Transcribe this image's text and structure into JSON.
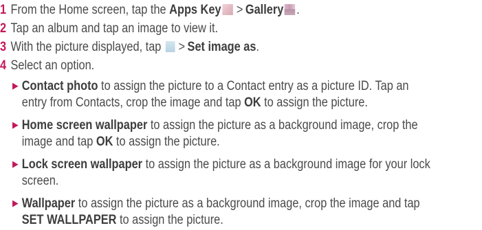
{
  "steps": [
    {
      "num": "1",
      "pre": "From the Home screen, tap the",
      "key1": "Apps Key",
      "sep": ">",
      "key2": "Gallery",
      "post": "."
    },
    {
      "num": "2",
      "text": "Tap an album and tap an image to view it."
    },
    {
      "num": "3",
      "pre": "With the picture displayed, tap",
      "sep": ">",
      "key": "Set image as",
      "post": "."
    },
    {
      "num": "4",
      "text": "Select an option."
    }
  ],
  "options": [
    {
      "term": "Contact photo",
      "line1": " to assign the picture to a Contact entry as a picture ID. Tap an",
      "line2a": "entry from Contacts, crop the image and tap ",
      "line2key": "OK",
      "line2b": " to assign the picture."
    },
    {
      "term": "Home screen wallpaper",
      "line1": " to assign the picture as a background image, crop the",
      "line2a": "image and tap ",
      "line2key": "OK",
      "line2b": " to assign the picture."
    },
    {
      "term": "Lock screen wallpaper",
      "line1": " to assign the picture as a background image for your lock",
      "line2a": "screen."
    },
    {
      "term": "Wallpaper",
      "line1": " to assign the picture as a background image, crop the image and tap",
      "line2key": "SET WALLPAPER",
      "line2b": " to assign the picture."
    }
  ],
  "icons": {
    "apps_key": "apps-key-icon",
    "gallery": "gallery-icon",
    "menu": "menu-icon"
  },
  "colors": {
    "accent": "#c3185b",
    "text": "#4a4a4a"
  }
}
